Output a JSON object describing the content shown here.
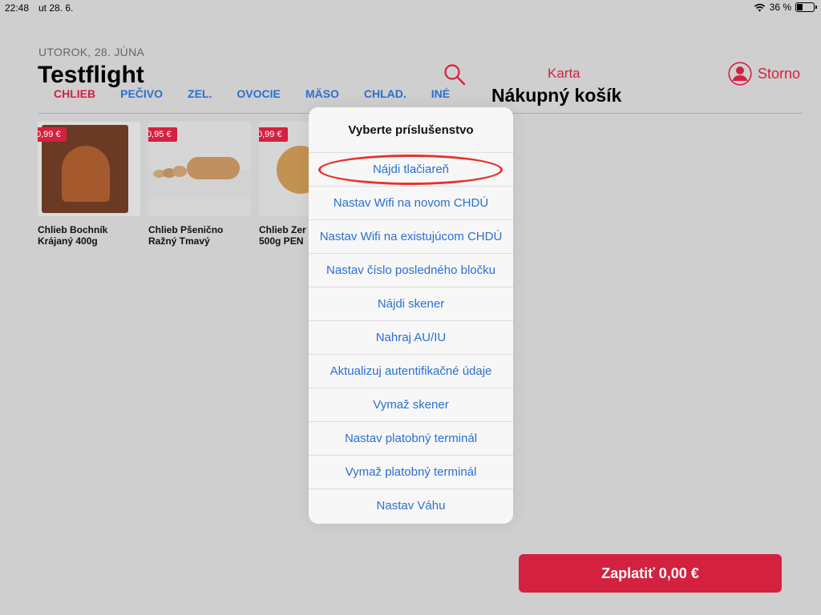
{
  "status_bar": {
    "time": "22:48",
    "date": "ut 28. 6.",
    "battery_percent_label": "36 %",
    "battery_level": 0.36,
    "icons": [
      "wifi-icon",
      "battery-icon"
    ]
  },
  "header": {
    "date_label": "UTOROK, 28. JÚNA",
    "app_title": "Testflight",
    "karta_label": "Karta",
    "cart_title": "Nákupný košík",
    "storno_label": "Storno"
  },
  "categories": [
    {
      "label": "CHLIEB",
      "active": true
    },
    {
      "label": "PEČIVO",
      "active": false
    },
    {
      "label": "ZEL.",
      "active": false
    },
    {
      "label": "OVOCIE",
      "active": false
    },
    {
      "label": "MÄSO",
      "active": false
    },
    {
      "label": "CHLAD.",
      "active": false
    },
    {
      "label": "INÉ",
      "active": false
    }
  ],
  "products": [
    {
      "price": "0,99 €",
      "name_line1": "Chlieb Bochník",
      "name_line2": "Krájaný 400g"
    },
    {
      "price": "0,95 €",
      "name_line1": "Chlieb Pšenično",
      "name_line2": "Ražný Tmavý"
    },
    {
      "price": "0,99 €",
      "name_line1": "Chlieb Zer",
      "name_line2": "500g PEN"
    }
  ],
  "popover": {
    "title": "Vyberte príslušenstvo",
    "items": [
      "Nájdi tlačiareň",
      "Nastav Wifi na novom CHDÚ",
      "Nastav Wifi na existujúcom CHDÚ",
      "Nastav číslo posledného bločku",
      "Nájdi skener",
      "Nahraj AU/IU",
      "Aktualizuj autentifikačné údaje",
      "Vymaž skener",
      "Nastav platobný terminál",
      "Vymaž platobný terminál",
      "Nastav Váhu"
    ]
  },
  "pay_button": {
    "label": "Zaplatiť 0,00 €"
  },
  "colors": {
    "accent_red": "#d4213f",
    "link_blue": "#2a6fd2",
    "highlight_ring": "#e8322a"
  }
}
